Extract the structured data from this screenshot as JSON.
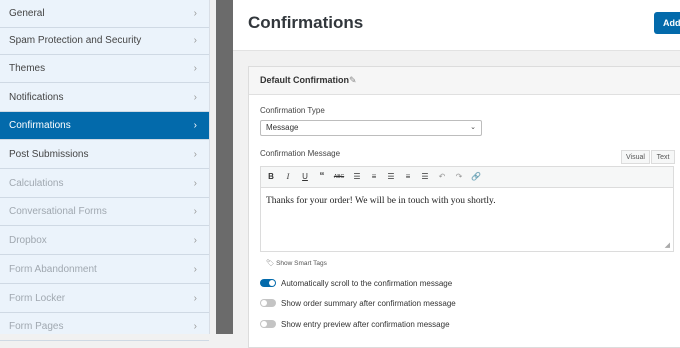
{
  "sidebar": {
    "items": [
      {
        "label": "General",
        "state": "normal"
      },
      {
        "label": "Spam Protection and Security",
        "state": "normal"
      },
      {
        "label": "Themes",
        "state": "normal"
      },
      {
        "label": "Notifications",
        "state": "normal"
      },
      {
        "label": "Confirmations",
        "state": "active"
      },
      {
        "label": "Post Submissions",
        "state": "normal"
      },
      {
        "label": "Calculations",
        "state": "disabled"
      },
      {
        "label": "Conversational Forms",
        "state": "disabled"
      },
      {
        "label": "Dropbox",
        "state": "disabled"
      },
      {
        "label": "Form Abandonment",
        "state": "disabled"
      },
      {
        "label": "Form Locker",
        "state": "disabled"
      },
      {
        "label": "Form Pages",
        "state": "disabled"
      }
    ],
    "chevron_icon": "chevron-right-icon"
  },
  "header": {
    "title": "Confirmations",
    "add_label": "Add"
  },
  "panel": {
    "title": "Default Confirmation",
    "edit_icon": "pencil-icon",
    "type_label": "Confirmation Type",
    "type_value": "Message",
    "message_label": "Confirmation Message",
    "tabs": [
      "Visual",
      "Text"
    ],
    "toolbar": [
      "bold",
      "italic",
      "underline",
      "blockquote",
      "strikethrough",
      "bulleted-list",
      "numbered-list",
      "align-left",
      "align-center",
      "align-right",
      "undo",
      "redo",
      "link"
    ],
    "message_text": "Thanks for your order! We will be in touch with you shortly.",
    "smart_tags_label": "Show Smart Tags",
    "toggles": [
      {
        "label": "Automatically scroll to the confirmation message",
        "on": true
      },
      {
        "label": "Show order summary after confirmation message",
        "on": false
      },
      {
        "label": "Show entry preview after confirmation message",
        "on": false
      }
    ]
  },
  "colors": {
    "accent": "#036aab",
    "sidebar_bg": "#ebf3fb",
    "toggle_off": "#c4c4c4"
  }
}
